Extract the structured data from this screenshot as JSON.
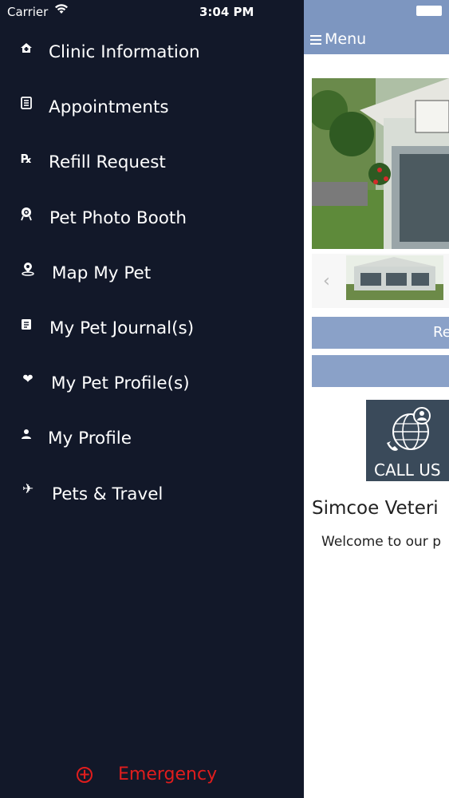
{
  "status_bar": {
    "carrier": "Carrier",
    "time": "3:04 PM"
  },
  "drawer": {
    "items": [
      {
        "label": "Clinic Information",
        "icon": "clinic-icon"
      },
      {
        "label": "Appointments",
        "icon": "appointments-icon"
      },
      {
        "label": "Refill Request",
        "icon": "rx-icon"
      },
      {
        "label": "Pet Photo Booth",
        "icon": "photo-booth-icon"
      },
      {
        "label": "Map My Pet",
        "icon": "map-pin-icon"
      },
      {
        "label": "My Pet Journal(s)",
        "icon": "journal-icon"
      },
      {
        "label": "My Pet Profile(s)",
        "icon": "heart-icon"
      },
      {
        "label": "My Profile",
        "icon": "person-icon"
      },
      {
        "label": "Pets & Travel",
        "icon": "airplane-icon"
      }
    ],
    "emergency_label": "Emergency",
    "emergency_color": "#e01d1d",
    "background_color": "#121829"
  },
  "main": {
    "menu_label": "Menu",
    "topbar_color": "#7d96c0",
    "button1_label": "Re",
    "call_us_label": "CALL US",
    "heading": "Simcoe Veteri",
    "welcome": "Welcome to our p"
  }
}
